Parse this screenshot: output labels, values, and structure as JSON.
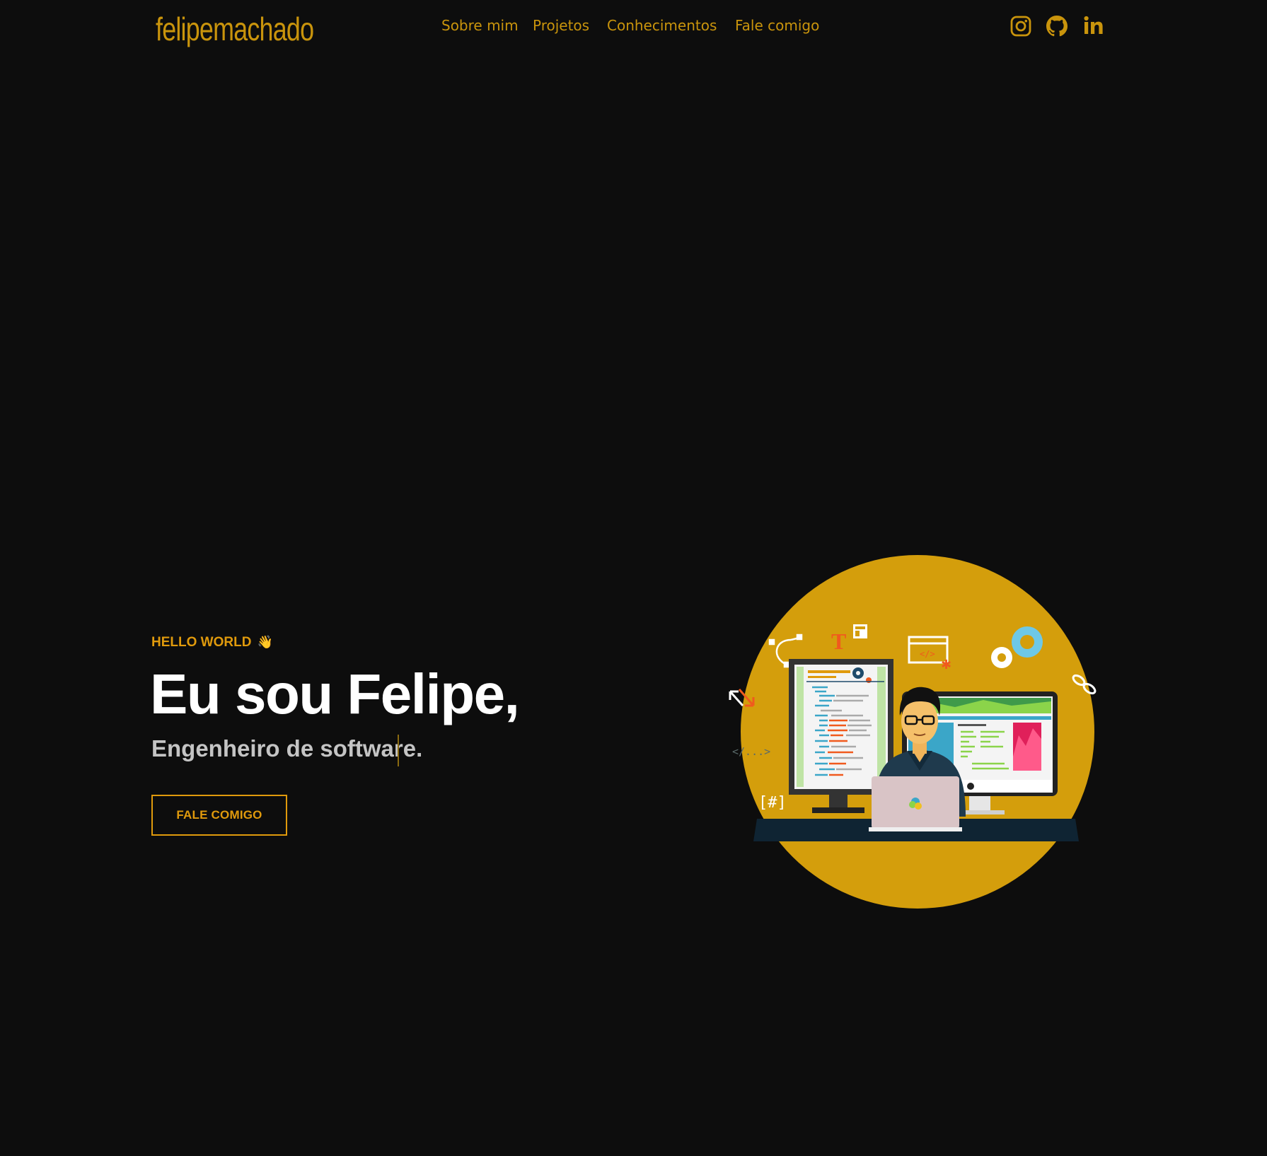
{
  "brand": {
    "logo_text": "felipemachado"
  },
  "nav": {
    "items": [
      {
        "label": "Sobre mim"
      },
      {
        "label": "Projetos"
      },
      {
        "label": "Conhecimentos"
      },
      {
        "label": "Fale comigo"
      }
    ]
  },
  "social": {
    "icons": [
      "instagram-icon",
      "github-icon",
      "linkedin-icon"
    ]
  },
  "hero": {
    "kicker": "HELLO WORLD",
    "kicker_emoji": "👋",
    "title": "Eu sou Felipe,",
    "subtitle": "Engenheiro de software.",
    "cta_label": "FALE COMIGO"
  },
  "illustration": {
    "code_tag": "</...>",
    "hash_tag": "[#]",
    "code_window_tag": "</>",
    "text_tool": "T"
  },
  "colors": {
    "background": "#0d0d0d",
    "accent": "#c9940c",
    "accent_bright": "#e09a0c",
    "circle": "#d49e0c",
    "title": "#ffffff",
    "subtitle": "#c4c4c4"
  }
}
